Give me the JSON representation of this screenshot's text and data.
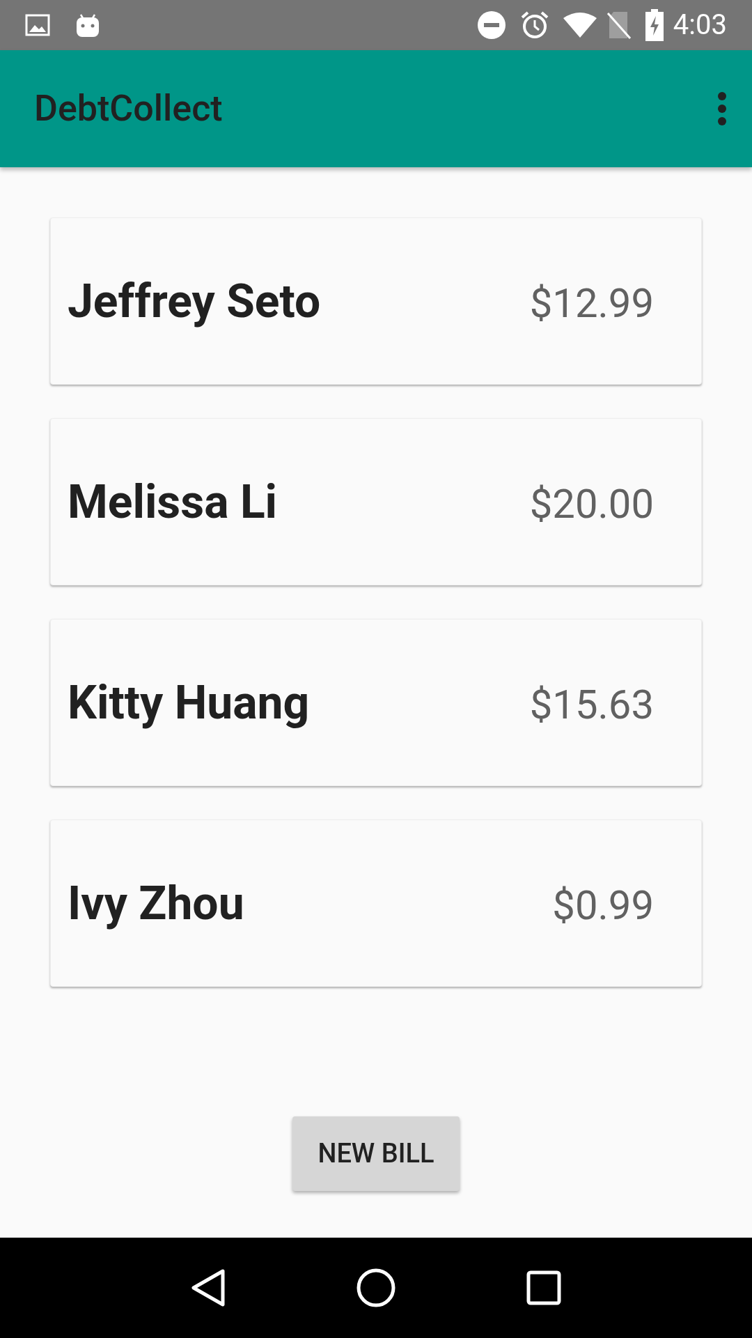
{
  "status_bar": {
    "time": "4:03"
  },
  "app_bar": {
    "title": "DebtCollect"
  },
  "debts": [
    {
      "name": "Jeffrey Seto",
      "amount": "$12.99"
    },
    {
      "name": "Melissa Li",
      "amount": "$20.00"
    },
    {
      "name": "Kitty Huang",
      "amount": "$15.63"
    },
    {
      "name": "Ivy Zhou",
      "amount": "$0.99"
    }
  ],
  "new_bill_button": {
    "label": "NEW BILL"
  }
}
